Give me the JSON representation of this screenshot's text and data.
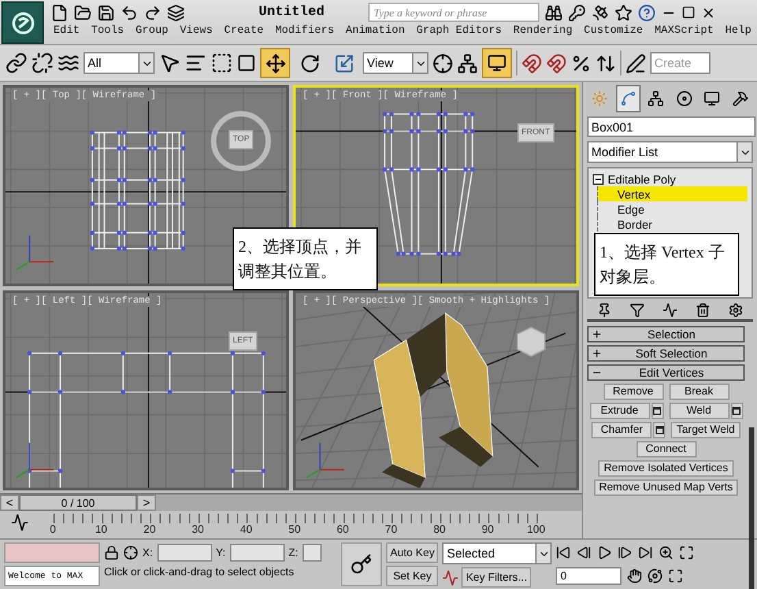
{
  "title_bar": {
    "title": "Untitled",
    "search": {
      "placeholder": "Type a keyword or phrase"
    }
  },
  "menu": [
    "Edit",
    "Tools",
    "Group",
    "Views",
    "Create",
    "Modifiers",
    "Animation",
    "Graph Editors",
    "Rendering",
    "Customize",
    "MAXScript",
    "Help"
  ],
  "toolbar": {
    "selection_filter": "All",
    "reference_coordinate": "View",
    "named_selection": {
      "placeholder": "Create"
    },
    "transform_tools": [
      {
        "kind": "move",
        "selected": true
      },
      {
        "kind": "rotate",
        "selected": false
      },
      {
        "kind": "scale",
        "selected": false
      }
    ],
    "panel_toggle": {
      "on": true
    }
  },
  "viewports": [
    {
      "kind": "top",
      "label": "[ + ][ Top ][ Wireframe ]",
      "cube_label": "TOP",
      "selected": false
    },
    {
      "kind": "front",
      "label": "[ + ][ Front ][ Wireframe ]",
      "cube_label": "FRONT",
      "selected": true
    },
    {
      "kind": "left",
      "label": "[ + ][ Left ][ Wireframe ]",
      "cube_label": "LEFT",
      "selected": false
    },
    {
      "kind": "perspective",
      "label": "[ + ][ Perspective ][ Smooth + Highlights ]",
      "selected": false
    }
  ],
  "annotations": [
    {
      "text": "2、选择顶点，并调整其位置。"
    },
    {
      "text": "1、选择 Vertex 子对象层。"
    }
  ],
  "command_panel": {
    "tabs": [
      {
        "kind": "create",
        "selected": false
      },
      {
        "kind": "modify",
        "selected": true
      },
      {
        "kind": "hierarchy",
        "selected": false
      },
      {
        "kind": "motion",
        "selected": false
      },
      {
        "kind": "display",
        "selected": false
      },
      {
        "kind": "utilities",
        "selected": false
      }
    ],
    "object_name": "Box001",
    "modifier_list": "Modifier List",
    "stack": [
      {
        "name": "Editable Poly",
        "expanded": true,
        "children": [
          {
            "name": "Vertex",
            "selected": true
          },
          {
            "name": "Edge",
            "selected": false
          },
          {
            "name": "Border",
            "selected": false
          }
        ]
      }
    ],
    "rollouts": [
      {
        "title": "Selection",
        "expanded": false
      },
      {
        "title": "Soft Selection",
        "expanded": false
      },
      {
        "title": "Edit Vertices",
        "expanded": true,
        "button_rows": [
          [
            {
              "label": "Remove",
              "settings": false
            },
            {
              "label": "Break",
              "settings": false
            }
          ],
          [
            {
              "label": "Extrude",
              "settings": true
            },
            {
              "label": "Weld",
              "settings": true
            }
          ],
          [
            {
              "label": "Chamfer",
              "settings": true
            },
            {
              "label": "Target Weld",
              "settings": false
            }
          ],
          [
            {
              "label": "Connect",
              "settings": false
            }
          ],
          [
            {
              "label": "Remove Isolated Vertices",
              "settings": false
            }
          ],
          [
            {
              "label": "Remove Unused Map Verts",
              "settings": false
            }
          ]
        ]
      }
    ]
  },
  "time_slider": {
    "prev": "<",
    "position": "0 / 100",
    "next": ">",
    "level": 0
  },
  "track_bar": {
    "ticks": [
      "0",
      "10",
      "20",
      "30",
      "40",
      "50",
      "60",
      "70",
      "80",
      "90",
      "100"
    ]
  },
  "status": {
    "listener_output": "Welcome to MAX",
    "prompt": "Click or click-and-drag to select objects",
    "coord_labels": [
      "X:",
      "Y:",
      "Z:"
    ]
  },
  "animation": {
    "auto_key": "Auto Key",
    "set_key": "Set Key",
    "key_mode": "Selected",
    "key_filters": "Key Filters...",
    "frame": "0"
  }
}
